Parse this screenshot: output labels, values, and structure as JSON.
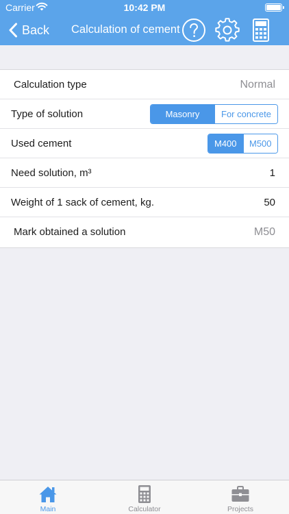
{
  "status_bar": {
    "carrier": "Carrier",
    "time": "10:42 PM",
    "wifi_icon": "wifi-icon",
    "battery_icon": "battery-icon"
  },
  "nav": {
    "back_label": "Back",
    "title": "Calculation of cement",
    "help_icon": "question-circle-icon",
    "settings_icon": "gear-icon",
    "calculator_icon": "calculator-icon"
  },
  "form": {
    "calculation_type": {
      "label": "Calculation type",
      "value": "Normal"
    },
    "type_of_solution": {
      "label": "Type of solution",
      "options": [
        "Masonry",
        "For concrete"
      ],
      "selected": "Masonry"
    },
    "used_cement": {
      "label": "Used cement",
      "options": [
        "M400",
        "M500"
      ],
      "selected": "M400"
    },
    "need_solution": {
      "label": "Need solution, m³",
      "value": "1"
    },
    "sack_weight": {
      "label": "Weight of 1 sack of cement, kg.",
      "value": "50"
    },
    "mark_obtained": {
      "label": "Mark obtained a solution",
      "value": "M50"
    }
  },
  "tabbar": {
    "tabs": [
      {
        "label": "Main",
        "icon": "home-icon",
        "active": true
      },
      {
        "label": "Calculator",
        "icon": "calculator-icon",
        "active": false
      },
      {
        "label": "Projects",
        "icon": "briefcase-icon",
        "active": false
      }
    ]
  },
  "colors": {
    "accent": "#4a97e8",
    "nav_background": "#5ba4ea",
    "page_background": "#efeff4",
    "inactive_tab": "#8e8e93"
  }
}
